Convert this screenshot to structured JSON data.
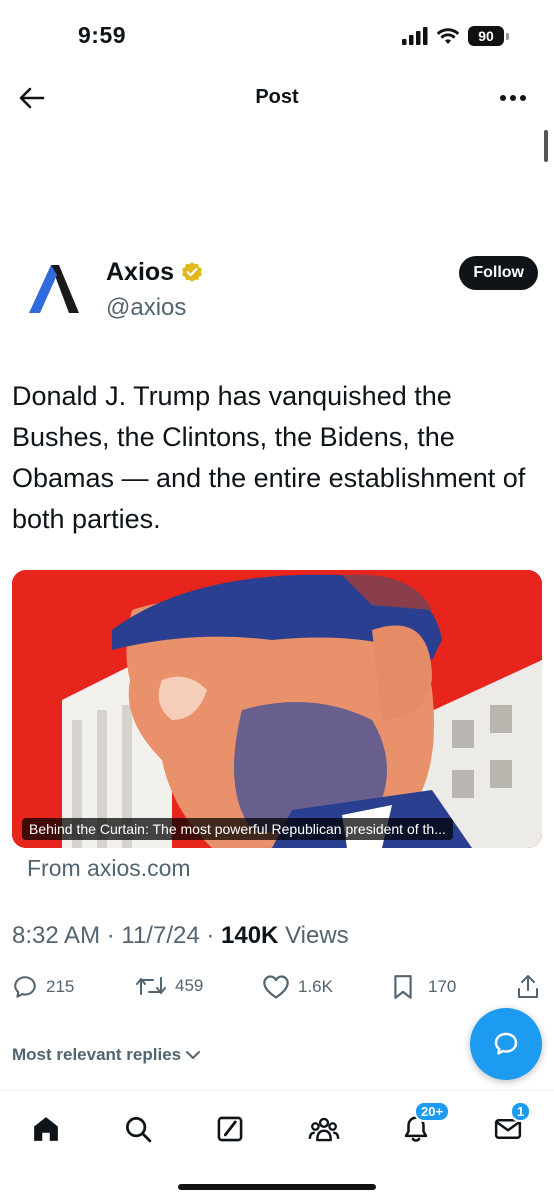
{
  "status_bar": {
    "time": "9:59",
    "battery": "90"
  },
  "header": {
    "title": "Post"
  },
  "author": {
    "name": "Axios",
    "handle": "@axios",
    "follow_label": "Follow"
  },
  "tweet": {
    "text": "Donald J. Trump has vanquished the Bushes, the Clintons, the Bidens, the Obamas — and the entire establishment of both parties."
  },
  "media": {
    "caption": "Behind the Curtain: The most powerful Republican president of th...",
    "source": "From axios.com"
  },
  "meta": {
    "time": "8:32 AM",
    "date": "11/7/24",
    "views_count": "140K",
    "views_label": "Views",
    "separator": " · "
  },
  "actions": {
    "replies": "215",
    "reposts": "459",
    "likes": "1.6K",
    "bookmarks": "170"
  },
  "replies_filter": {
    "label": "Most relevant replies"
  },
  "bottom_nav": {
    "notifications_badge": "20+",
    "messages_badge": "1"
  },
  "colors": {
    "accent": "#1d9bf0",
    "text": "#0f1419",
    "secondary": "#536471",
    "verified": "#e2b719",
    "media_red": "#e8251c",
    "media_blue": "#2a3f8f"
  },
  "icons": [
    "back-arrow-icon",
    "more-icon",
    "verified-badge-icon",
    "reply-icon",
    "repost-icon",
    "like-icon",
    "bookmark-icon",
    "share-icon",
    "chevron-down-icon",
    "compose-reply-icon",
    "home-icon",
    "search-icon",
    "grok-icon",
    "communities-icon",
    "notifications-icon",
    "messages-icon"
  ]
}
